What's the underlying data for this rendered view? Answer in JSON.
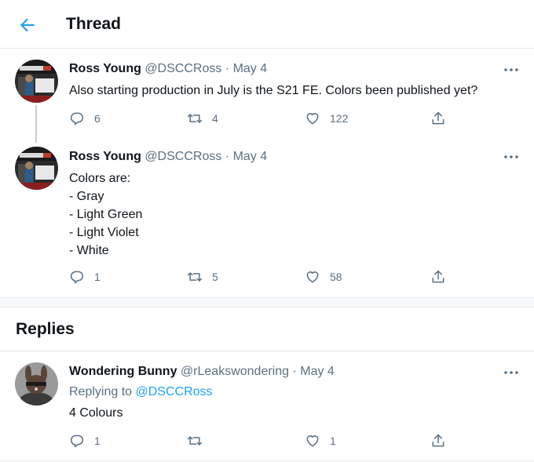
{
  "header": {
    "title": "Thread",
    "back_icon": "arrow-left-icon",
    "accent": "#1da1f2"
  },
  "tweets": [
    {
      "name": "Ross Young",
      "handle": "@DSCCRoss",
      "sep": "·",
      "date": "May 4",
      "text_lines": [
        "Also starting production in July is the S21 FE. Colors been published yet?"
      ],
      "replies": "6",
      "retweets": "4",
      "likes": "122"
    },
    {
      "name": "Ross Young",
      "handle": "@DSCCRoss",
      "sep": "·",
      "date": "May 4",
      "text_lines": [
        "Colors are:",
        "- Gray",
        "- Light Green",
        "- Light Violet",
        "- White"
      ],
      "replies": "1",
      "retweets": "5",
      "likes": "58"
    }
  ],
  "replies_section": {
    "title": "Replies"
  },
  "reply": {
    "name": "Wondering Bunny",
    "handle": "@rLeakswondering",
    "sep": "·",
    "date": "May 4",
    "replying_prefix": "Replying to",
    "replying_handle": "@DSCCRoss",
    "text": "4 Colours",
    "replies": "1",
    "retweets": "",
    "likes": "1"
  },
  "icons": {
    "reply": "speech-bubble-icon",
    "retweet": "retweet-icon",
    "like": "heart-icon",
    "share": "share-icon",
    "more": "more-dots-icon"
  },
  "colors": {
    "text": "#0f1419",
    "muted": "#5b7083",
    "link": "#1da1f2",
    "border": "#e6ecf0"
  }
}
